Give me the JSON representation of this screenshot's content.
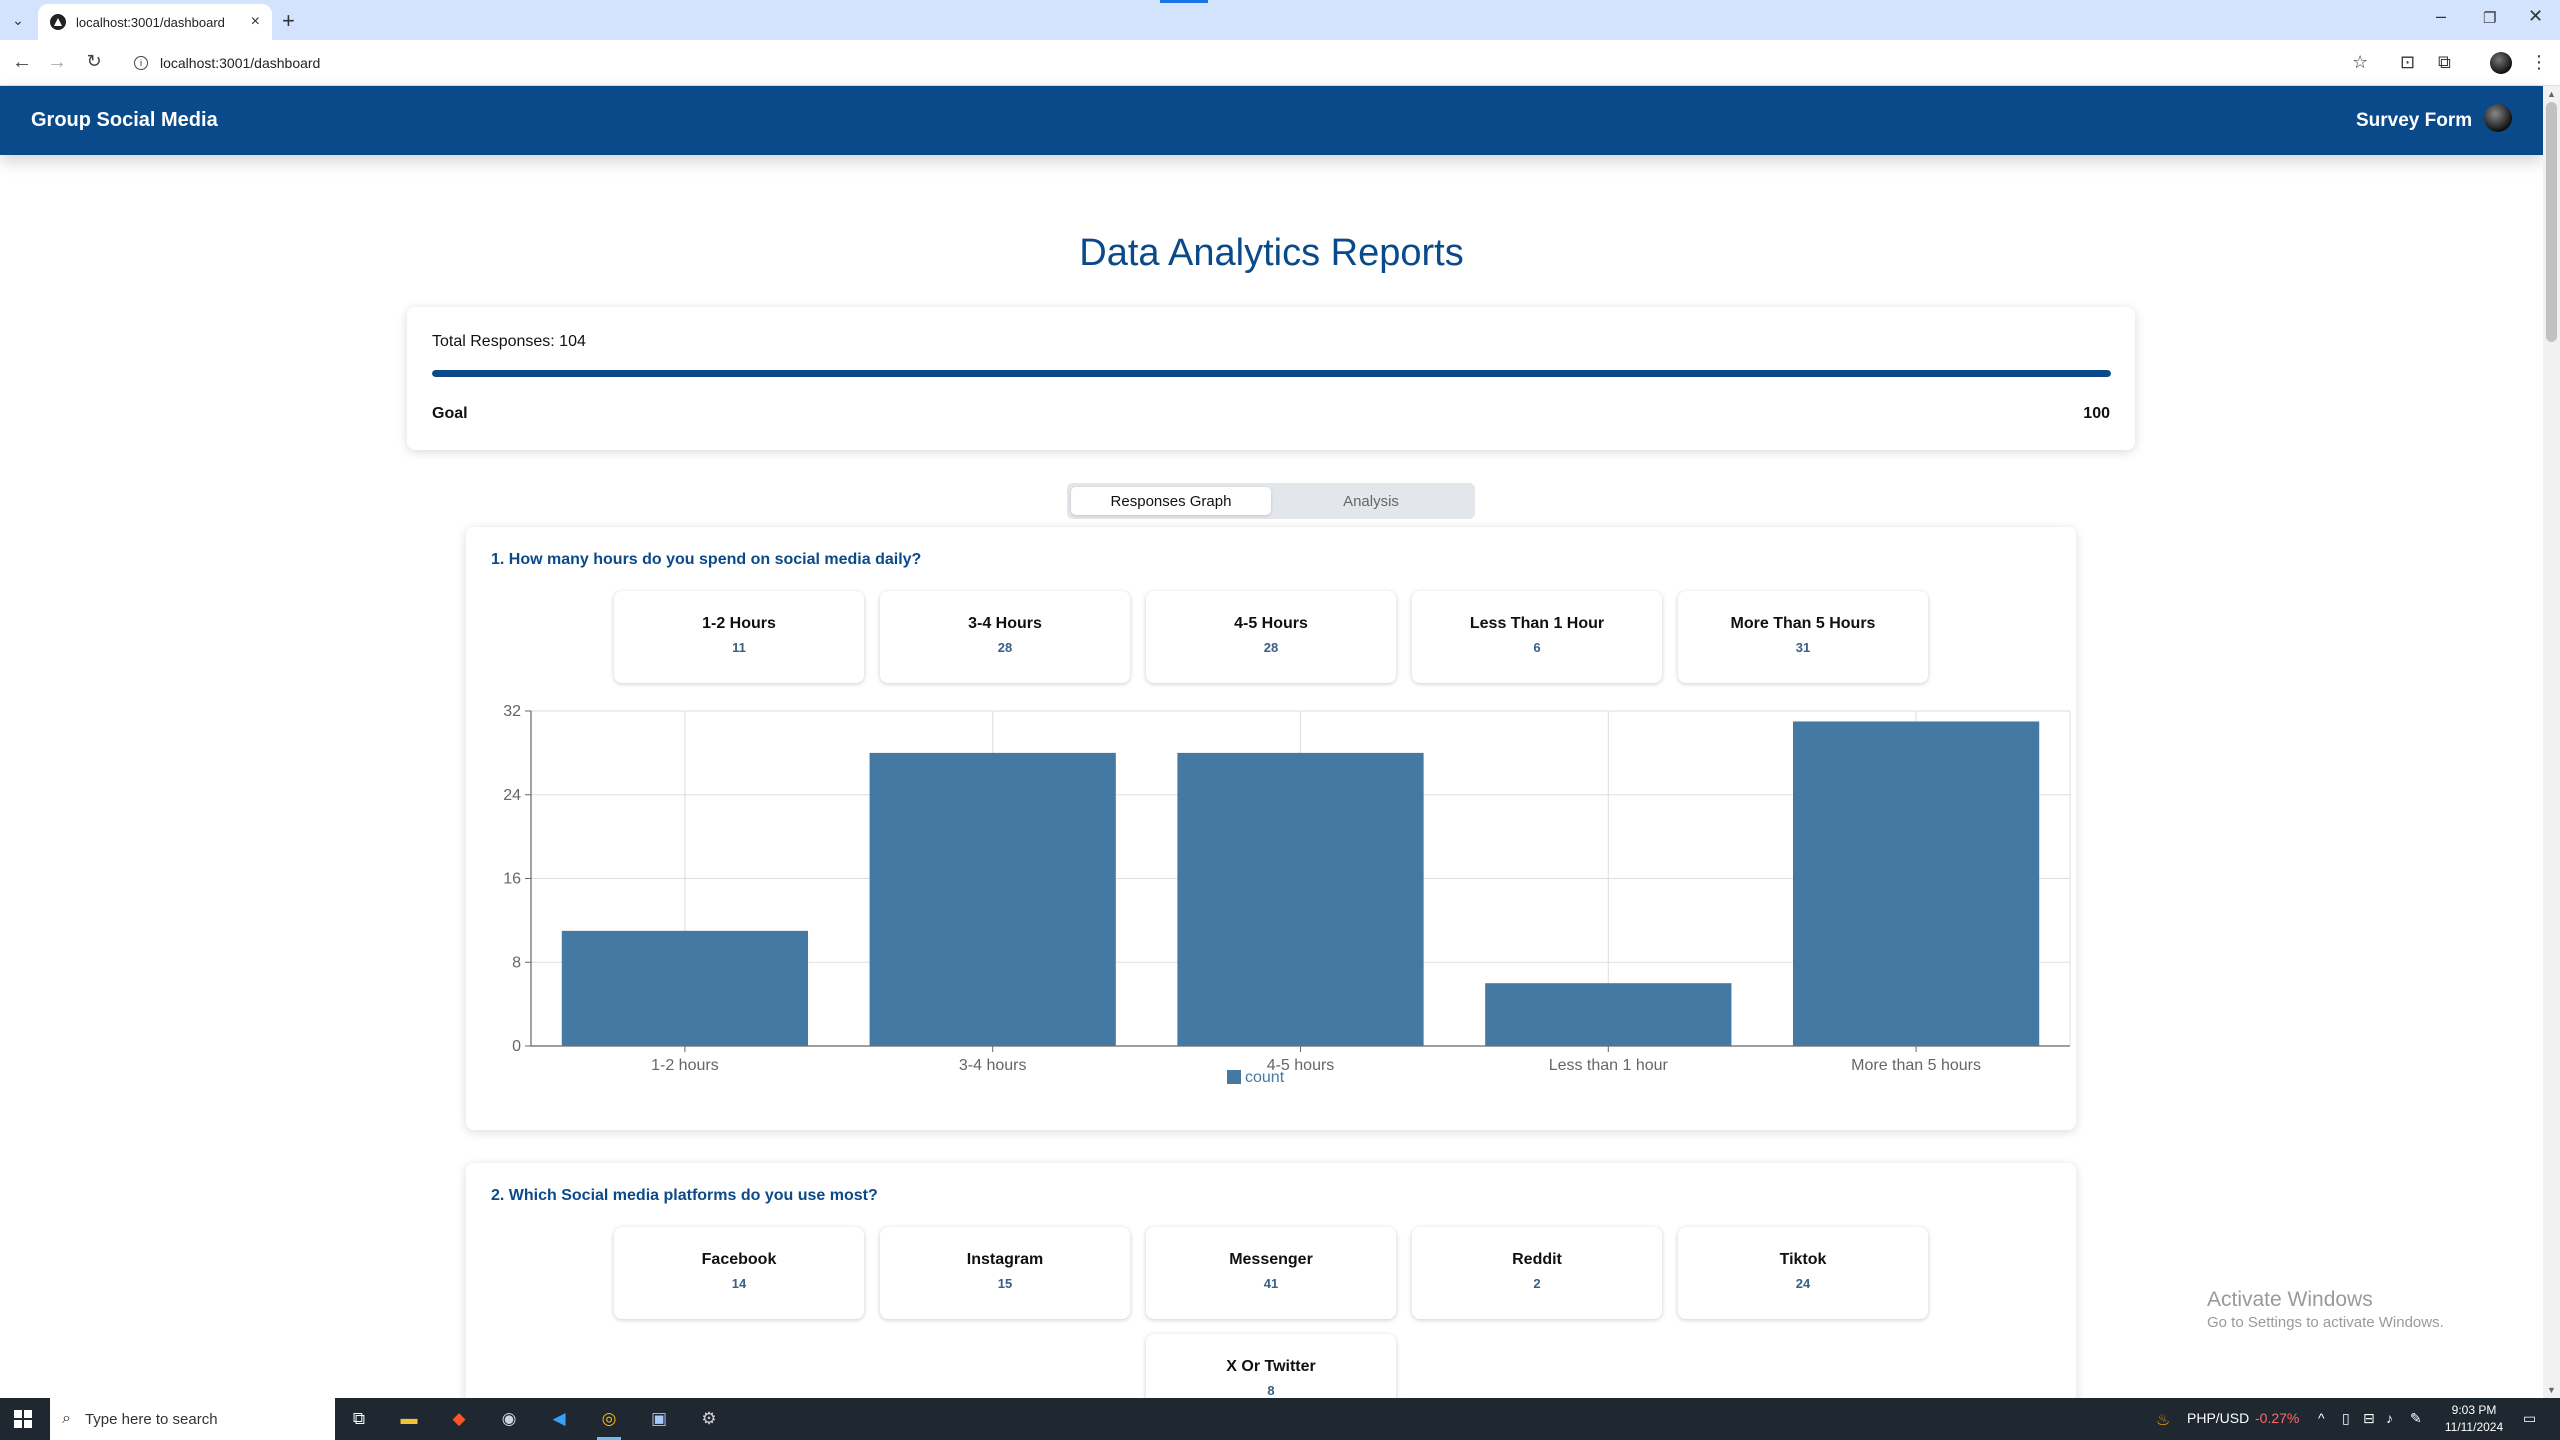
{
  "browser": {
    "tab_title": "localhost:3001/dashboard",
    "url": "localhost:3001/dashboard"
  },
  "header": {
    "brand": "Group Social Media",
    "survey_link": "Survey Form"
  },
  "page": {
    "title": "Data Analytics Reports"
  },
  "summary": {
    "total_label": "Total Responses: 104",
    "progress_fraction": 1.0,
    "goal_label": "Goal",
    "goal_value": "100"
  },
  "tabs": [
    {
      "label": "Responses Graph",
      "active": true
    },
    {
      "label": "Analysis",
      "active": false
    }
  ],
  "questions": [
    {
      "title": "1. How many hours do you spend on social media daily?",
      "options": [
        {
          "label": "1-2 Hours",
          "count": "11"
        },
        {
          "label": "3-4 Hours",
          "count": "28"
        },
        {
          "label": "4-5 Hours",
          "count": "28"
        },
        {
          "label": "Less Than 1 Hour",
          "count": "6"
        },
        {
          "label": "More Than 5 Hours",
          "count": "31"
        }
      ]
    },
    {
      "title": "2. Which Social media platforms do you use most?",
      "options": [
        {
          "label": "Facebook",
          "count": "14"
        },
        {
          "label": "Instagram",
          "count": "15"
        },
        {
          "label": "Messenger",
          "count": "41"
        },
        {
          "label": "Reddit",
          "count": "2"
        },
        {
          "label": "Tiktok",
          "count": "24"
        },
        {
          "label": "X Or Twitter",
          "count": "8"
        }
      ]
    }
  ],
  "chart_data": {
    "type": "bar",
    "categories": [
      "1-2 hours",
      "3-4 hours",
      "4-5 hours",
      "Less than 1 hour",
      "More than 5 hours"
    ],
    "series": [
      {
        "name": "count",
        "values": [
          11,
          28,
          28,
          6,
          31
        ]
      }
    ],
    "yticks": [
      0,
      8,
      16,
      24,
      32
    ],
    "ylim": [
      0,
      32
    ],
    "grid": true,
    "legend": "bottom-center",
    "bar_color": "#4479a3"
  },
  "watermark": {
    "title": "Activate Windows",
    "subtitle": "Go to Settings to activate Windows."
  },
  "taskbar": {
    "search_placeholder": "Type here to search",
    "ticker_label": "PHP/USD",
    "ticker_value": "-0.27%",
    "time": "9:03 PM",
    "date": "11/11/2024"
  },
  "colors": {
    "brand": "#0b4a8a",
    "accent_text": "#3a5f86"
  }
}
